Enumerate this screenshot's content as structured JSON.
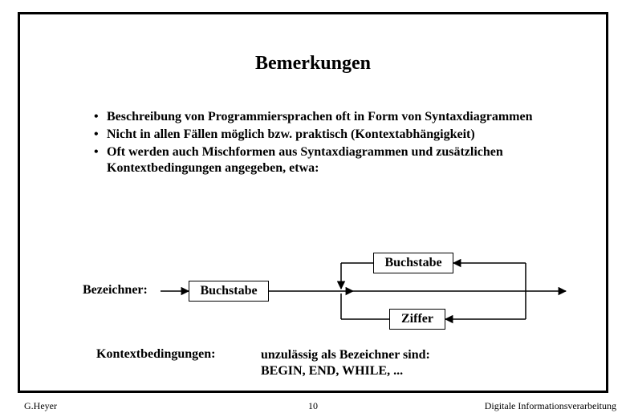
{
  "title": "Bemerkungen",
  "bullets": [
    "Beschreibung von Programmiersprachen oft in Form von Syntaxdiagrammen",
    "Nicht in allen Fällen möglich bzw. praktisch (Kontextabhängigkeit)",
    "Oft werden auch Mischformen aus Syntaxdiagrammen und zusätzlichen Kontextbedingungen angegeben, etwa:"
  ],
  "diagram": {
    "label": "Bezeichner:",
    "box_main": "Buchstabe",
    "box_top": "Buchstabe",
    "box_bottom": "Ziffer"
  },
  "kontext": {
    "label": "Kontextbedingungen:",
    "line1": "unzulässig als Bezeichner sind:",
    "line2": "BEGIN, END, WHILE, ..."
  },
  "footer": {
    "left": "G.Heyer",
    "center": "10",
    "right": "Digitale Informationsverarbeitung"
  }
}
